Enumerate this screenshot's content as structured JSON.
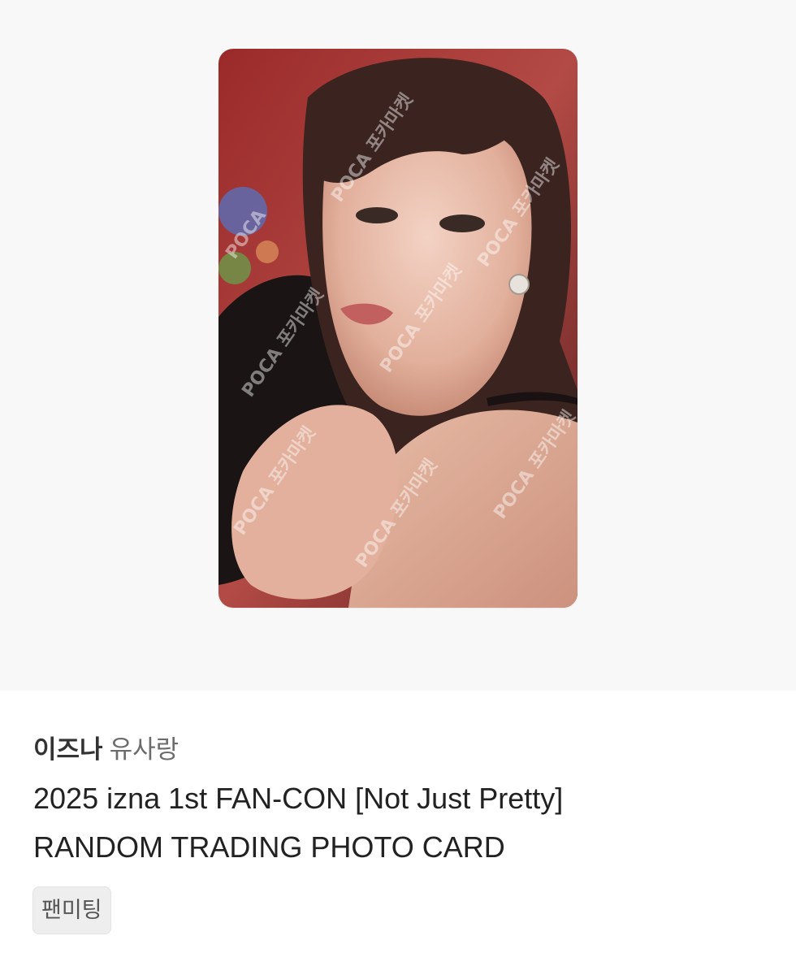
{
  "photocard": {
    "image_alt": "photo card image",
    "watermark_text": "POCA 포카마켓"
  },
  "product": {
    "artist": "이즈나",
    "member": "유사랑",
    "title_line1": "2025 izna 1st FAN-CON [Not Just Pretty]",
    "title_line2": "RANDOM TRADING PHOTO CARD",
    "tag": "팬미팅"
  },
  "colors": {
    "hero_background": "#f8f8f8",
    "tag_background": "#eeeeee",
    "text_primary": "#222222",
    "text_secondary": "#6b6b6b"
  }
}
